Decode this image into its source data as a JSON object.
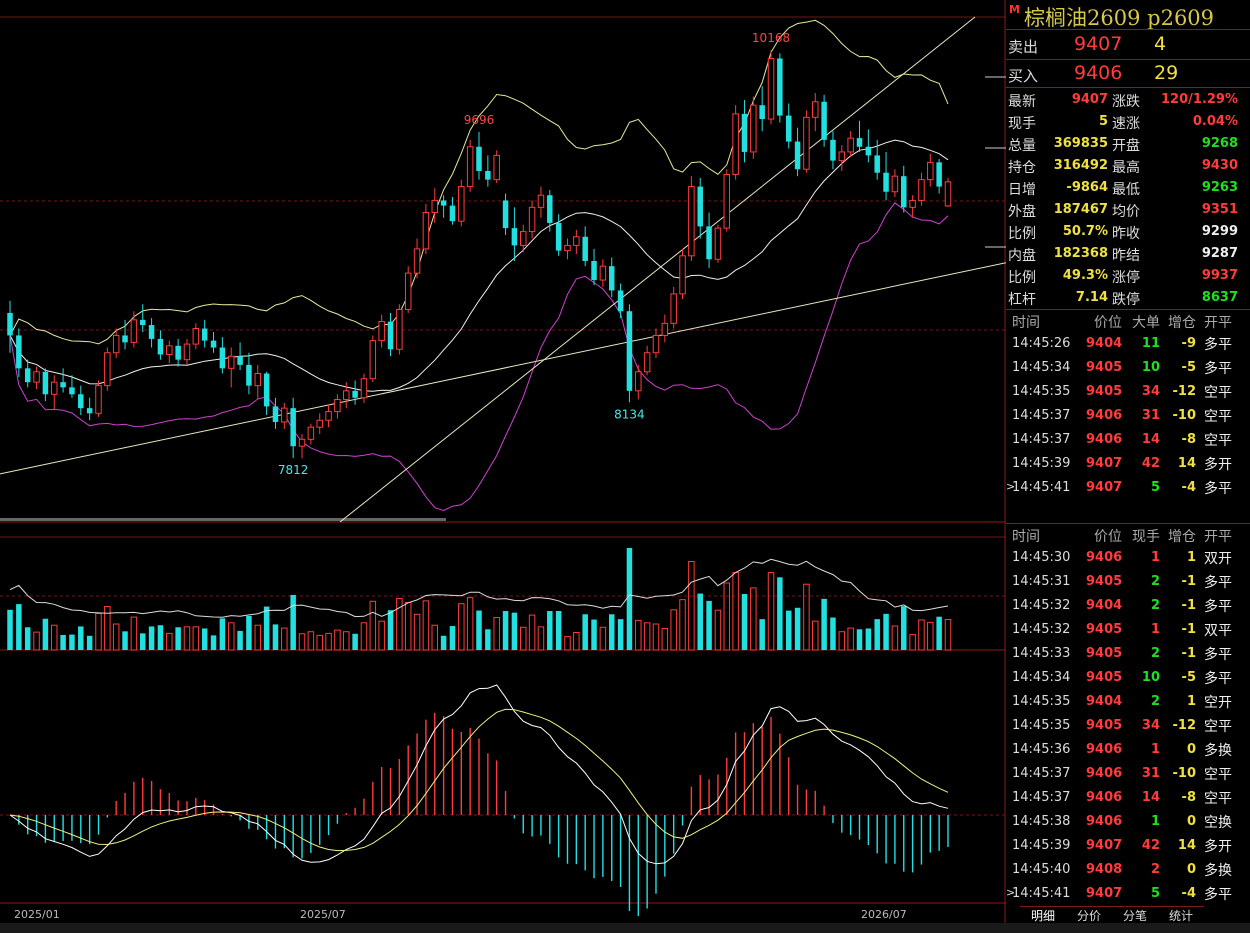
{
  "instrument": {
    "name": "棕榈油2609",
    "code": "p2609",
    "badge": "M"
  },
  "orderbook": {
    "ask": {
      "label": "卖出",
      "price": "9407",
      "volume": "4"
    },
    "bid": {
      "label": "买入",
      "price": "9406",
      "volume": "29"
    }
  },
  "quote": [
    {
      "l": "最新",
      "lv": "9407",
      "lc": "red",
      "r": "涨跌",
      "rv": "120/1.29%",
      "rc": "red"
    },
    {
      "l": "现手",
      "lv": "5",
      "lc": "yellow",
      "r": "速涨",
      "rv": "0.04%",
      "rc": "red"
    },
    {
      "l": "总量",
      "lv": "369835",
      "lc": "yellow",
      "r": "开盘",
      "rv": "9268",
      "rc": "green"
    },
    {
      "l": "持仓",
      "lv": "316492",
      "lc": "yellow",
      "r": "最高",
      "rv": "9430",
      "rc": "red"
    },
    {
      "l": "日增",
      "lv": "-9864",
      "lc": "yellow",
      "r": "最低",
      "rv": "9263",
      "rc": "green"
    },
    {
      "l": "外盘",
      "lv": "187467",
      "lc": "yellow",
      "r": "均价",
      "rv": "9351",
      "rc": "red"
    },
    {
      "l": "比例",
      "lv": "50.7%",
      "lc": "yellow",
      "r": "昨收",
      "rv": "9299",
      "rc": "white"
    },
    {
      "l": "内盘",
      "lv": "182368",
      "lc": "yellow",
      "r": "昨结",
      "rv": "9287",
      "rc": "white"
    },
    {
      "l": "比例",
      "lv": "49.3%",
      "lc": "yellow",
      "r": "涨停",
      "rv": "9937",
      "rc": "red"
    },
    {
      "l": "杠杆",
      "lv": "7.14",
      "lc": "yellow",
      "r": "跌停",
      "rv": "8637",
      "rc": "green"
    }
  ],
  "ticks1": {
    "headers": [
      "时间",
      "价位",
      "大单",
      "增仓",
      "开平"
    ],
    "rows": [
      {
        "t": "14:45:26",
        "p": "9404",
        "pc": "red",
        "a": "11",
        "ac": "green",
        "b": "-9",
        "bc": "yellow",
        "k": "多平",
        "kc": "white"
      },
      {
        "t": "14:45:34",
        "p": "9405",
        "pc": "red",
        "a": "10",
        "ac": "green",
        "b": "-5",
        "bc": "yellow",
        "k": "多平",
        "kc": "white"
      },
      {
        "t": "14:45:35",
        "p": "9405",
        "pc": "red",
        "a": "34",
        "ac": "red",
        "b": "-12",
        "bc": "yellow",
        "k": "空平",
        "kc": "white"
      },
      {
        "t": "14:45:37",
        "p": "9406",
        "pc": "red",
        "a": "31",
        "ac": "red",
        "b": "-10",
        "bc": "yellow",
        "k": "空平",
        "kc": "white"
      },
      {
        "t": "14:45:37",
        "p": "9406",
        "pc": "red",
        "a": "14",
        "ac": "red",
        "b": "-8",
        "bc": "yellow",
        "k": "空平",
        "kc": "white"
      },
      {
        "t": "14:45:39",
        "p": "9407",
        "pc": "red",
        "a": "42",
        "ac": "red",
        "b": "14",
        "bc": "yellow",
        "k": "多开",
        "kc": "white"
      },
      {
        "t": "14:45:41",
        "p": "9407",
        "pc": "red",
        "a": "5",
        "ac": "green",
        "b": "-4",
        "bc": "yellow",
        "k": "多平",
        "kc": "white"
      }
    ]
  },
  "ticks2": {
    "headers": [
      "时间",
      "价位",
      "现手",
      "增仓",
      "开平"
    ],
    "rows": [
      {
        "t": "14:45:30",
        "p": "9406",
        "pc": "red",
        "a": "1",
        "ac": "red",
        "b": "1",
        "bc": "yellow",
        "k": "双开",
        "kc": "white"
      },
      {
        "t": "14:45:31",
        "p": "9405",
        "pc": "red",
        "a": "2",
        "ac": "green",
        "b": "-1",
        "bc": "yellow",
        "k": "多平",
        "kc": "white"
      },
      {
        "t": "14:45:32",
        "p": "9404",
        "pc": "red",
        "a": "2",
        "ac": "green",
        "b": "-1",
        "bc": "yellow",
        "k": "多平",
        "kc": "white"
      },
      {
        "t": "14:45:32",
        "p": "9405",
        "pc": "red",
        "a": "1",
        "ac": "red",
        "b": "-1",
        "bc": "yellow",
        "k": "双平",
        "kc": "white"
      },
      {
        "t": "14:45:33",
        "p": "9405",
        "pc": "red",
        "a": "2",
        "ac": "green",
        "b": "-1",
        "bc": "yellow",
        "k": "多平",
        "kc": "white"
      },
      {
        "t": "14:45:34",
        "p": "9405",
        "pc": "red",
        "a": "10",
        "ac": "green",
        "b": "-5",
        "bc": "yellow",
        "k": "多平",
        "kc": "white"
      },
      {
        "t": "14:45:35",
        "p": "9404",
        "pc": "red",
        "a": "2",
        "ac": "green",
        "b": "1",
        "bc": "yellow",
        "k": "空开",
        "kc": "white"
      },
      {
        "t": "14:45:35",
        "p": "9405",
        "pc": "red",
        "a": "34",
        "ac": "red",
        "b": "-12",
        "bc": "yellow",
        "k": "空平",
        "kc": "white"
      },
      {
        "t": "14:45:36",
        "p": "9406",
        "pc": "red",
        "a": "1",
        "ac": "red",
        "b": "0",
        "bc": "yellow",
        "k": "多换",
        "kc": "white"
      },
      {
        "t": "14:45:37",
        "p": "9406",
        "pc": "red",
        "a": "31",
        "ac": "red",
        "b": "-10",
        "bc": "yellow",
        "k": "空平",
        "kc": "white"
      },
      {
        "t": "14:45:37",
        "p": "9406",
        "pc": "red",
        "a": "14",
        "ac": "red",
        "b": "-8",
        "bc": "yellow",
        "k": "空平",
        "kc": "white"
      },
      {
        "t": "14:45:38",
        "p": "9406",
        "pc": "red",
        "a": "1",
        "ac": "green",
        "b": "0",
        "bc": "yellow",
        "k": "空换",
        "kc": "white"
      },
      {
        "t": "14:45:39",
        "p": "9407",
        "pc": "red",
        "a": "42",
        "ac": "red",
        "b": "14",
        "bc": "yellow",
        "k": "多开",
        "kc": "white"
      },
      {
        "t": "14:45:40",
        "p": "9408",
        "pc": "red",
        "a": "2",
        "ac": "red",
        "b": "0",
        "bc": "yellow",
        "k": "多换",
        "kc": "white"
      },
      {
        "t": "14:45:41",
        "p": "9407",
        "pc": "red",
        "a": "5",
        "ac": "green",
        "b": "-4",
        "bc": "yellow",
        "k": "多平",
        "kc": "white"
      }
    ]
  },
  "tabs": [
    "明细",
    "分价",
    "分笔",
    "统计"
  ],
  "chart_data": {
    "type": "candlestick",
    "x_labels": [
      "2025/01",
      "2025/07",
      "2026/07"
    ],
    "annotations": [
      {
        "label": "10168",
        "value": 10168,
        "kind": "high"
      },
      {
        "label": "9696",
        "value": 9696,
        "kind": "high"
      },
      {
        "label": "7812",
        "value": 7812,
        "kind": "low"
      },
      {
        "label": "8134",
        "value": 8134,
        "kind": "low"
      }
    ],
    "ylim": [
      7500,
      10400
    ],
    "colors": {
      "up": "#ff3b3b",
      "down": "#22e0e0",
      "ma": "#f0f0f0",
      "boll": "#e8e89a",
      "lower": "#d040d0",
      "dif": "#ffffff",
      "dea": "#f0f080"
    },
    "candles": [
      [
        8650,
        8720,
        8420,
        8520
      ],
      [
        8520,
        8560,
        8280,
        8330
      ],
      [
        8330,
        8380,
        8220,
        8250
      ],
      [
        8250,
        8340,
        8210,
        8310
      ],
      [
        8310,
        8330,
        8140,
        8180
      ],
      [
        8180,
        8290,
        8090,
        8250
      ],
      [
        8250,
        8330,
        8190,
        8220
      ],
      [
        8220,
        8290,
        8160,
        8180
      ],
      [
        8180,
        8230,
        8060,
        8100
      ],
      [
        8100,
        8160,
        8030,
        8070
      ],
      [
        8070,
        8260,
        8050,
        8230
      ],
      [
        8230,
        8450,
        8200,
        8420
      ],
      [
        8420,
        8560,
        8390,
        8520
      ],
      [
        8520,
        8610,
        8440,
        8480
      ],
      [
        8480,
        8660,
        8450,
        8610
      ],
      [
        8610,
        8700,
        8540,
        8580
      ],
      [
        8580,
        8620,
        8450,
        8500
      ],
      [
        8500,
        8550,
        8380,
        8410
      ],
      [
        8410,
        8490,
        8360,
        8460
      ],
      [
        8460,
        8500,
        8340,
        8380
      ],
      [
        8380,
        8500,
        8350,
        8470
      ],
      [
        8470,
        8590,
        8440,
        8560
      ],
      [
        8560,
        8610,
        8450,
        8490
      ],
      [
        8490,
        8540,
        8420,
        8450
      ],
      [
        8450,
        8510,
        8300,
        8330
      ],
      [
        8330,
        8450,
        8220,
        8400
      ],
      [
        8400,
        8480,
        8320,
        8350
      ],
      [
        8350,
        8420,
        8180,
        8230
      ],
      [
        8230,
        8350,
        8150,
        8300
      ],
      [
        8300,
        8310,
        8060,
        8110
      ],
      [
        8110,
        8160,
        7980,
        8020
      ],
      [
        8020,
        8130,
        7980,
        8100
      ],
      [
        8100,
        8160,
        7812,
        7880
      ],
      [
        7880,
        7950,
        7810,
        7920
      ],
      [
        7920,
        8010,
        7890,
        7990
      ],
      [
        7990,
        8070,
        7950,
        8030
      ],
      [
        8030,
        8120,
        7990,
        8080
      ],
      [
        8080,
        8180,
        8040,
        8150
      ],
      [
        8150,
        8250,
        8100,
        8200
      ],
      [
        8200,
        8260,
        8120,
        8160
      ],
      [
        8160,
        8300,
        8130,
        8270
      ],
      [
        8270,
        8520,
        8250,
        8490
      ],
      [
        8490,
        8640,
        8450,
        8600
      ],
      [
        8600,
        8650,
        8400,
        8440
      ],
      [
        8440,
        8700,
        8410,
        8670
      ],
      [
        8670,
        8920,
        8650,
        8880
      ],
      [
        8880,
        9080,
        8850,
        9020
      ],
      [
        9020,
        9280,
        8990,
        9230
      ],
      [
        9230,
        9370,
        9170,
        9300
      ],
      [
        9300,
        9330,
        9200,
        9270
      ],
      [
        9270,
        9320,
        9160,
        9180
      ],
      [
        9180,
        9420,
        9150,
        9380
      ],
      [
        9380,
        9650,
        9350,
        9610
      ],
      [
        9610,
        9696,
        9420,
        9470
      ],
      [
        9470,
        9560,
        9380,
        9420
      ],
      [
        9420,
        9590,
        9400,
        9560
      ],
      [
        9300,
        9340,
        9100,
        9140
      ],
      [
        9140,
        9260,
        8950,
        9040
      ],
      [
        9040,
        9160,
        9000,
        9120
      ],
      [
        9120,
        9300,
        9080,
        9260
      ],
      [
        9260,
        9380,
        9200,
        9330
      ],
      [
        9330,
        9360,
        9120,
        9170
      ],
      [
        9170,
        9220,
        8980,
        9010
      ],
      [
        9010,
        9080,
        8960,
        9040
      ],
      [
        9040,
        9130,
        8990,
        9090
      ],
      [
        9090,
        9150,
        8920,
        8950
      ],
      [
        8950,
        9020,
        8810,
        8840
      ],
      [
        8840,
        8960,
        8800,
        8920
      ],
      [
        8920,
        8970,
        8740,
        8780
      ],
      [
        8780,
        8820,
        8620,
        8660
      ],
      [
        8660,
        8700,
        8134,
        8200
      ],
      [
        8200,
        8350,
        8150,
        8310
      ],
      [
        8310,
        8460,
        8290,
        8420
      ],
      [
        8420,
        8560,
        8390,
        8520
      ],
      [
        8520,
        8640,
        8480,
        8590
      ],
      [
        8590,
        8800,
        8560,
        8760
      ],
      [
        8760,
        9020,
        8730,
        8980
      ],
      [
        8980,
        9440,
        8950,
        9380
      ],
      [
        9380,
        9430,
        9080,
        9150
      ],
      [
        9150,
        9230,
        8910,
        8960
      ],
      [
        8960,
        9160,
        8940,
        9140
      ],
      [
        9140,
        9480,
        9120,
        9450
      ],
      [
        9450,
        9850,
        9420,
        9800
      ],
      [
        9800,
        9880,
        9520,
        9580
      ],
      [
        9580,
        9900,
        9540,
        9850
      ],
      [
        9850,
        9960,
        9700,
        9770
      ],
      [
        9770,
        10168,
        9740,
        10120
      ],
      [
        10120,
        10150,
        9750,
        9790
      ],
      [
        9790,
        9860,
        9600,
        9640
      ],
      [
        9640,
        9720,
        9440,
        9480
      ],
      [
        9480,
        9820,
        9460,
        9780
      ],
      [
        9780,
        9920,
        9700,
        9870
      ],
      [
        9870,
        9910,
        9610,
        9650
      ],
      [
        9650,
        9700,
        9480,
        9530
      ],
      [
        9530,
        9620,
        9470,
        9580
      ],
      [
        9580,
        9700,
        9550,
        9660
      ],
      [
        9660,
        9760,
        9580,
        9610
      ],
      [
        9610,
        9710,
        9520,
        9560
      ],
      [
        9560,
        9650,
        9420,
        9460
      ],
      [
        9460,
        9580,
        9300,
        9350
      ],
      [
        9350,
        9480,
        9320,
        9440
      ],
      [
        9440,
        9500,
        9230,
        9260
      ],
      [
        9260,
        9330,
        9200,
        9300
      ],
      [
        9300,
        9460,
        9270,
        9420
      ],
      [
        9420,
        9570,
        9380,
        9520
      ],
      [
        9520,
        9540,
        9340,
        9380
      ],
      [
        9268,
        9430,
        9263,
        9407
      ]
    ],
    "volume_series": {
      "name": "",
      "values": []
    }
  }
}
